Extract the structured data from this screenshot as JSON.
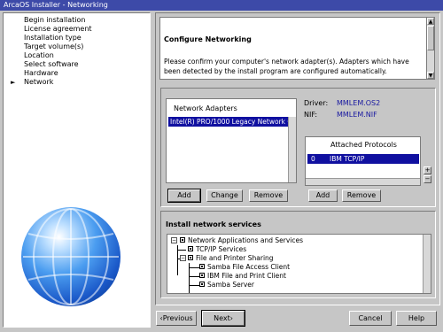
{
  "window": {
    "title": "ArcaOS Installer - Networking"
  },
  "steps": [
    {
      "label": "Begin installation",
      "current": false
    },
    {
      "label": "License agreement",
      "current": false
    },
    {
      "label": "Installation type",
      "current": false
    },
    {
      "label": "Target volume(s)",
      "current": false
    },
    {
      "label": "Location",
      "current": false
    },
    {
      "label": "Select software",
      "current": false
    },
    {
      "label": "Hardware",
      "current": false
    },
    {
      "label": "Network",
      "current": true
    }
  ],
  "step_marker": "►",
  "info": {
    "title": "Configure Networking",
    "text": "Please confirm your computer's network adapter(s). Adapters which have been detected by the install program are configured  automatically."
  },
  "adapters": {
    "header": "Network Adapters",
    "items": [
      "Intel(R) PRO/1000 Legacy Network Co"
    ],
    "buttons": {
      "add": "Add",
      "change": "Change",
      "remove": "Remove"
    }
  },
  "driver": {
    "driver_label": "Driver:",
    "driver_value": "MMLEM.OS2",
    "nif_label": "NIF:",
    "nif_value": "MMLEM.NIF"
  },
  "protocols": {
    "header": "Attached Protocols",
    "items": [
      {
        "index": "0",
        "name": "IBM TCP/IP"
      }
    ],
    "buttons": {
      "add": "Add",
      "remove": "Remove"
    }
  },
  "services": {
    "title": "Install network services",
    "tree": [
      {
        "label": "Network Applications and Services",
        "level": 0
      },
      {
        "label": "TCP/IP Services",
        "level": 1
      },
      {
        "label": "File and Printer Sharing",
        "level": 1
      },
      {
        "label": "Samba File Access Client",
        "level": 2
      },
      {
        "label": "IBM File and Print Client",
        "level": 2
      },
      {
        "label": "Samba Server",
        "level": 2
      }
    ]
  },
  "nav": {
    "previous": "Previous",
    "next": "Next",
    "cancel": "Cancel",
    "help": "Help"
  },
  "colors": {
    "titlebar": "#3d4aa8",
    "selection": "#1010a0",
    "link": "#1818a0",
    "background": "#c6c6c6"
  },
  "icons": [
    "globe-icon",
    "arrow-up-icon",
    "arrow-down-icon",
    "arrow-left-icon",
    "arrow-right-icon",
    "plus-icon",
    "minus-icon"
  ]
}
